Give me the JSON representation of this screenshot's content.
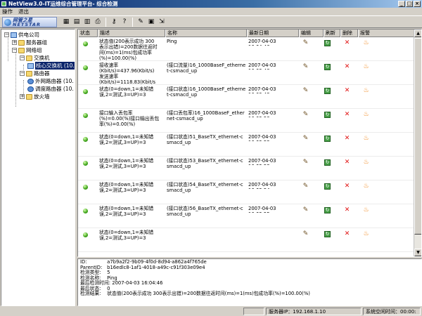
{
  "window": {
    "title": "NetView3.0-IT运维综合管理平台- 综合检测",
    "minimize": "_",
    "maximize": "□",
    "close": "×"
  },
  "menu": [
    "操作",
    "退出"
  ],
  "logo": {
    "line1": "网管之星",
    "line2": "NETSTAR"
  },
  "toolbar_icons": [
    "table-icon",
    "tree-icon",
    "list-icon",
    "print-icon",
    "key-icon",
    "document-icon",
    "help-icon",
    "edit-icon",
    "log-icon",
    "exit-icon"
  ],
  "tree": [
    {
      "label": "供电公司",
      "icon": "computer",
      "expander": "−"
    },
    {
      "label": "服务器组",
      "icon": "folder",
      "expander": "+"
    },
    {
      "label": "网络组",
      "icon": "folder",
      "expander": "−"
    },
    {
      "label": "交换机",
      "icon": "folder",
      "expander": "−"
    },
    {
      "label": "核心交换机 (10.",
      "icon": "computer",
      "expander": ""
    },
    {
      "label": "路由器",
      "icon": "folder",
      "expander": "−"
    },
    {
      "label": "外网路由器 (10.",
      "icon": "router",
      "expander": ""
    },
    {
      "label": "调度路由器 (10.",
      "icon": "router",
      "expander": ""
    },
    {
      "label": "放火墙",
      "icon": "folder",
      "expander": "+"
    }
  ],
  "table": {
    "headers": [
      "状态",
      "描述",
      "名称",
      "最新日期",
      "编辑",
      "刷新",
      "删除",
      "报警"
    ],
    "rows": [
      {
        "desc": "状态值(200表示成功 300\n表示出错)=200数据往返时\n间(ms)=1(ms)包成功率\n(%)=100.00(%)",
        "name": "Ping",
        "date": "2007-04-03 16:04:46"
      },
      {
        "desc": "接收速率\n(Kbit/s)=437.96(Kbit/s)\n发送速率\n(Kbit/s)=1118.83(Kbit/s",
        "name": "(接口流量)16_1000BaseF_etherne\nt-csmacd_up",
        "date": "2007-04-03 16:09:48"
      },
      {
        "desc": "状态(0=down,1=未知错\n误,2=测试,3=UP)=3",
        "name": "(接口状态)16_1000BaseF_etherne\nt-csmacd_up",
        "date": "2007-04-03 16:09:49"
      },
      {
        "desc": "接口输入丢包率\n(%)=0.00(%)接口输出丢包\n率(%)=0.00(%)",
        "name": "(接口丢包率)16_1000BaseF_ether\nnet-csmacd_up",
        "date": "2007-04-03 16:09:50"
      },
      {
        "desc": "状态(0=down,1=未知错\n误,2=测试,3=UP)=3",
        "name": "(接口状态)51_BaseTX_ethernet-c\nsmacd_up",
        "date": "2007-04-03 16:09:52"
      },
      {
        "desc": "状态(0=down,1=未知错\n误,2=测试,3=UP)=3",
        "name": "(接口状态)53_BaseTX_ethernet-c\nsmacd_up",
        "date": "2007-04-03 16:09:53"
      },
      {
        "desc": "状态(0=down,1=未知错\n误,2=测试,3=UP)=3",
        "name": "(接口状态)54_BaseTX_ethernet-c\nsmacd_up",
        "date": "2007-04-03 16:09:54"
      },
      {
        "desc": "状态(0=down,1=未知错\n误,2=测试,3=UP)=3",
        "name": "(接口状态)56_BaseTX_ethernet-c\nsmacd_up",
        "date": "2007-04-03 16:09:55"
      },
      {
        "desc": "状态(0=down,1=未知错\n误,2=测试,3=UP)=3",
        "name": "",
        "date": ""
      }
    ]
  },
  "detail": [
    {
      "k": "ID:",
      "v": "a7b9a2f2-9b09-4f0d-8d94-a862a4f765de"
    },
    {
      "k": "ParentID:",
      "v": "b16edlc8-1af1-4018-a49c-c91f303e09e4"
    },
    {
      "k": "检测类型:",
      "v": "5"
    },
    {
      "k": "检测名称:",
      "v": "Ping"
    },
    {
      "k": "最后检测时间:",
      "v": "2007-04-03 16:04:46"
    },
    {
      "k": "最后状态:",
      "v": "0"
    },
    {
      "k": "检测结果:",
      "v": "状态值(200表示成功 300表示出错)=200数据往返时间(ms)=1(ms)包成功率(%)=100.00(%)"
    }
  ],
  "statusbar": {
    "server_ip": "服务器IP：192.168.1.10",
    "system_time": "系统空闲时间：00:00:"
  }
}
